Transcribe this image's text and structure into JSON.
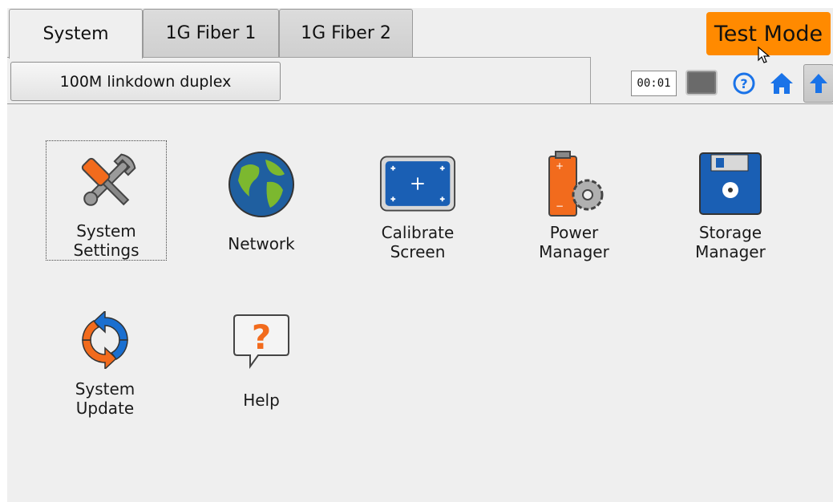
{
  "tabs": [
    {
      "label": "System",
      "active": true
    },
    {
      "label": "1G Fiber 1",
      "active": false
    },
    {
      "label": "1G Fiber 2",
      "active": false
    }
  ],
  "link_status": "100M linkdown duplex",
  "test_mode_label": "Test Mode",
  "timer": "00:01",
  "status_icons": [
    "battery-icon",
    "help-icon",
    "home-icon",
    "up-arrow-icon"
  ],
  "apps": [
    {
      "name": "System\nSettings",
      "icon": "wrench-screwdriver-icon"
    },
    {
      "name": "Network",
      "icon": "globe-icon"
    },
    {
      "name": "Calibrate\nScreen",
      "icon": "calibrate-screen-icon"
    },
    {
      "name": "Power\nManager",
      "icon": "battery-gear-icon"
    },
    {
      "name": "Storage\nManager",
      "icon": "floppy-disk-icon"
    },
    {
      "name": "System\nUpdate",
      "icon": "update-arrows-icon"
    },
    {
      "name": "Help",
      "icon": "question-bubble-icon"
    }
  ],
  "colors": {
    "accent": "#ff8a00",
    "icon_blue": "#1a73e8",
    "background": "#efefef"
  }
}
